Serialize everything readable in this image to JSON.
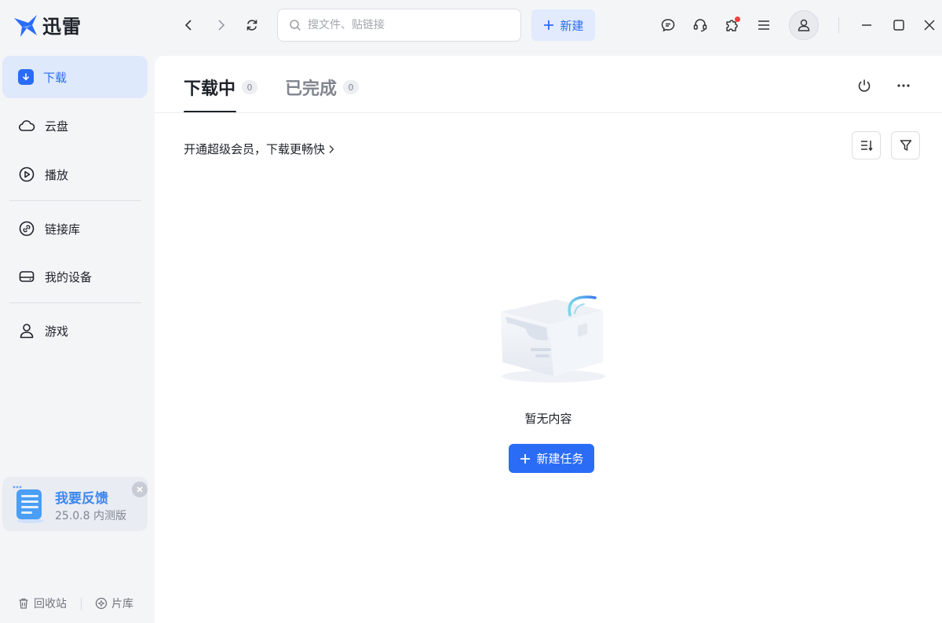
{
  "app": {
    "name": "迅雷",
    "logo_icon": "bird-logo-icon",
    "brand_color": "#2a6cf6"
  },
  "header": {
    "search_placeholder": "搜文件、贴链接",
    "new_label": "新建"
  },
  "sidebar": {
    "items": [
      {
        "label": "下载",
        "icon": "download-icon",
        "active": true
      },
      {
        "label": "云盘",
        "icon": "cloud-icon"
      },
      {
        "label": "播放",
        "icon": "play-icon"
      },
      {
        "label": "链接库",
        "icon": "link-icon"
      },
      {
        "label": "我的设备",
        "icon": "device-icon"
      },
      {
        "label": "游戏",
        "icon": "user-game-icon"
      }
    ],
    "feedback": {
      "title": "我要反馈",
      "version": "25.0.8 内测版"
    },
    "bottom": {
      "trash": "回收站",
      "library": "片库"
    }
  },
  "main": {
    "tabs": [
      {
        "label": "下载中",
        "count": "0",
        "active": true
      },
      {
        "label": "已完成",
        "count": "0",
        "active": false
      }
    ],
    "promo": "开通超级会员，下载更畅快",
    "empty_text": "暂无内容",
    "new_task_label": "新建任务"
  }
}
